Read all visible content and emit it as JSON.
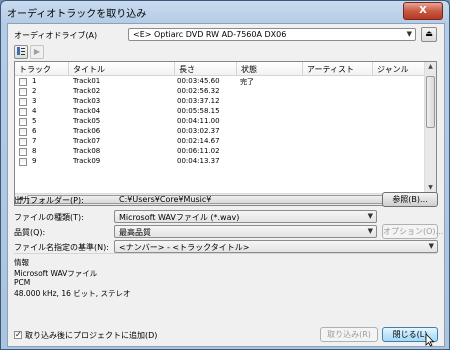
{
  "window": {
    "title": "オーディオトラックを取り込み",
    "close_label": "X"
  },
  "drive": {
    "label": "オーディオドライブ(A)",
    "value": "<E> Optiarc DVD RW AD-7560A DX06"
  },
  "toolbar": {
    "select_icon": "list-select-icon",
    "play_icon": "play-icon",
    "eject_icon": "eject-icon"
  },
  "track_list": {
    "columns": [
      "トラック",
      "タイトル",
      "長さ",
      "状態",
      "アーティスト",
      "ジャンル"
    ],
    "rows": [
      {
        "num": "1",
        "title": "Track01",
        "length": "00:03:45.60",
        "status": "完了"
      },
      {
        "num": "2",
        "title": "Track02",
        "length": "00:02:56.32",
        "status": ""
      },
      {
        "num": "3",
        "title": "Track03",
        "length": "00:03:37.12",
        "status": ""
      },
      {
        "num": "4",
        "title": "Track04",
        "length": "00:05:58.15",
        "status": ""
      },
      {
        "num": "5",
        "title": "Track05",
        "length": "00:04:11.00",
        "status": ""
      },
      {
        "num": "6",
        "title": "Track06",
        "length": "00:03:02.37",
        "status": ""
      },
      {
        "num": "7",
        "title": "Track07",
        "length": "00:02:14.67",
        "status": ""
      },
      {
        "num": "8",
        "title": "Track08",
        "length": "00:06:11.02",
        "status": ""
      },
      {
        "num": "9",
        "title": "Track09",
        "length": "00:04:13.37",
        "status": ""
      }
    ]
  },
  "output_folder": {
    "label": "出力フォルダー(P):",
    "value": "C:¥Users¥Core¥Music¥",
    "browse_label": "参照(B)..."
  },
  "file_type": {
    "label": "ファイルの種類(T):",
    "value": "Microsoft WAVファイル (*.wav)"
  },
  "quality": {
    "label": "品質(Q):",
    "value": "最高品質",
    "options_label": "オプション(O)..."
  },
  "naming": {
    "label": "ファイル名指定の基準(N):",
    "value": "<ナンバー> - <トラックタイトル>"
  },
  "info": {
    "heading": "情報",
    "line1": "Microsoft WAVファイル",
    "line2": "PCM",
    "line3": "48.000 kHz, 16 ビット, ステレオ"
  },
  "footer": {
    "add_to_project_label": "取り込み後にプロジェクトに追加(D)",
    "add_to_project_checked": true,
    "import_label": "取り込み(R)",
    "close_label": "閉じる(L)"
  },
  "colors": {
    "title_bar": "#b5cce6",
    "close_button": "#c85a45",
    "dialog_bg": "#f0f0f0"
  }
}
